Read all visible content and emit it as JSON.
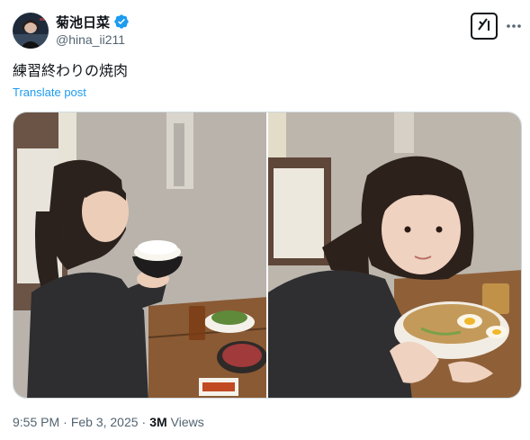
{
  "author": {
    "display_name": "菊池日菜",
    "handle": "@hina_ii211",
    "verified": true,
    "verified_color": "#1d9bf0"
  },
  "post": {
    "text": "練習終わりの焼肉",
    "translate_label": "Translate post"
  },
  "media": {
    "count": 2
  },
  "meta": {
    "time": "9:55 PM",
    "separator_1": "·",
    "date": "Feb 3, 2025",
    "separator_2": "·",
    "views_count": "3M",
    "views_label": "Views"
  },
  "colors": {
    "link": "#1d9bf0",
    "secondary_text": "#536471",
    "primary_text": "#0f1419",
    "border": "#cfd9de"
  },
  "icons": {
    "verified": "verified-badge-icon",
    "grok": "grok-icon",
    "more": "more-horizontal-icon"
  }
}
